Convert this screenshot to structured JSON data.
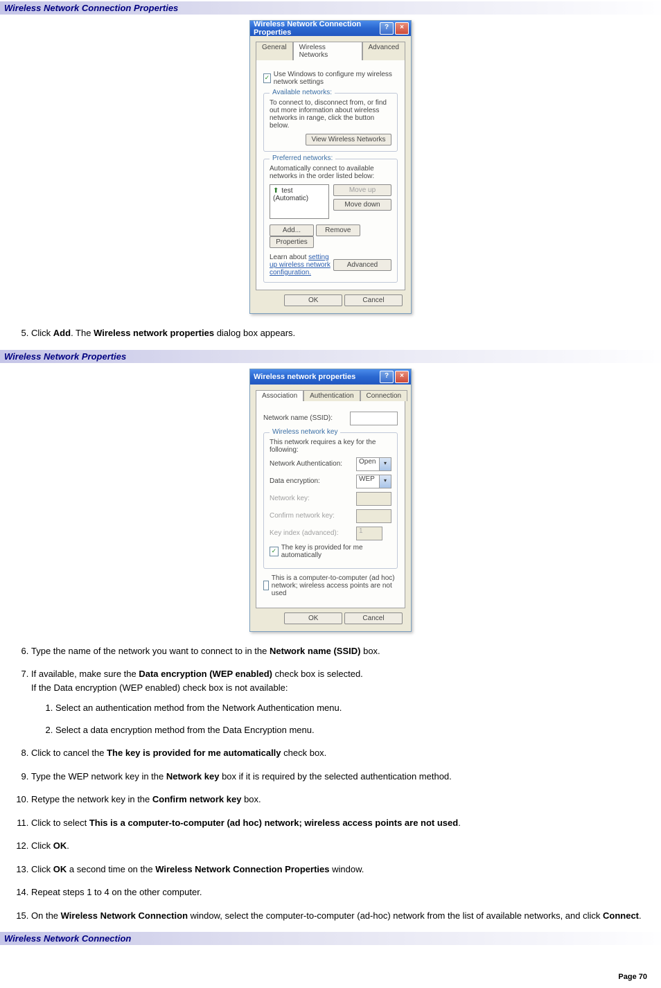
{
  "headers": {
    "h1": "Wireless Network Connection Properties",
    "h2": "Wireless Network Properties",
    "h3": "Wireless Network Connection"
  },
  "dlg1": {
    "title": "Wireless Network Connection Properties",
    "tabs": {
      "t1": "General",
      "t2": "Wireless Networks",
      "t3": "Advanced"
    },
    "use_windows": "Use Windows to configure my wireless network settings",
    "avail_legend": "Available networks:",
    "avail_text": "To connect to, disconnect from, or find out more information about wireless networks in range, click the button below.",
    "view_btn": "View Wireless Networks",
    "pref_legend": "Preferred networks:",
    "pref_text": "Automatically connect to available networks in the order listed below:",
    "pref_item": "test (Automatic)",
    "moveup": "Move up",
    "movedown": "Move down",
    "add": "Add...",
    "remove": "Remove",
    "properties": "Properties",
    "learn_a": "Learn about ",
    "learn_link": "setting up wireless network configuration.",
    "advanced": "Advanced",
    "ok": "OK",
    "cancel": "Cancel"
  },
  "dlg2": {
    "title": "Wireless network properties",
    "tabs": {
      "t1": "Association",
      "t2": "Authentication",
      "t3": "Connection"
    },
    "ssid": "Network name (SSID):",
    "key_legend": "Wireless network key",
    "key_text": "This network requires a key for the following:",
    "auth_label": "Network Authentication:",
    "auth_val": "Open",
    "enc_label": "Data encryption:",
    "enc_val": "WEP",
    "nkey": "Network key:",
    "ckey": "Confirm network key:",
    "kidx": "Key index (advanced):",
    "kidx_val": "1",
    "provided": "The key is provided for me automatically",
    "adhoc": "This is a computer-to-computer (ad hoc) network; wireless access points are not used",
    "ok": "OK",
    "cancel": "Cancel"
  },
  "steps": {
    "s5a": "Click ",
    "s5b": "Add",
    "s5c": ". The ",
    "s5d": "Wireless network properties",
    "s5e": " dialog box appears.",
    "s6a": "Type the name of the network you want to connect to in the ",
    "s6b": "Network name (SSID)",
    "s6c": " box.",
    "s7a": "If available, make sure the ",
    "s7b": "Data encryption (WEP enabled)",
    "s7c": " check box is selected.",
    "s7d": "If the Data encryption (WEP enabled) check box is not available:",
    "s7_1": "Select an authentication method from the Network Authentication menu.",
    "s7_2": "Select a data encryption method from the Data Encryption menu.",
    "s8a": "Click to cancel the ",
    "s8b": "The key is provided for me automatically",
    "s8c": " check box.",
    "s9a": "Type the WEP network key in the ",
    "s9b": "Network key",
    "s9c": " box if it is required by the selected authentication method.",
    "s10a": "Retype the network key in the ",
    "s10b": "Confirm network key",
    "s10c": " box.",
    "s11a": "Click to select ",
    "s11b": "This is a computer-to-computer (ad hoc) network; wireless access points are not used",
    "s11c": ".",
    "s12a": "Click ",
    "s12b": "OK",
    "s12c": ".",
    "s13a": "Click ",
    "s13b": "OK",
    "s13c": " a second time on the ",
    "s13d": "Wireless Network Connection Properties",
    "s13e": " window.",
    "s14": "Repeat steps 1 to 4 on the other computer.",
    "s15a": "On the ",
    "s15b": "Wireless Network Connection",
    "s15c": " window, select the computer-to-computer (ad-hoc) network from the list of available networks, and click ",
    "s15d": "Connect",
    "s15e": "."
  },
  "page": "Page 70"
}
